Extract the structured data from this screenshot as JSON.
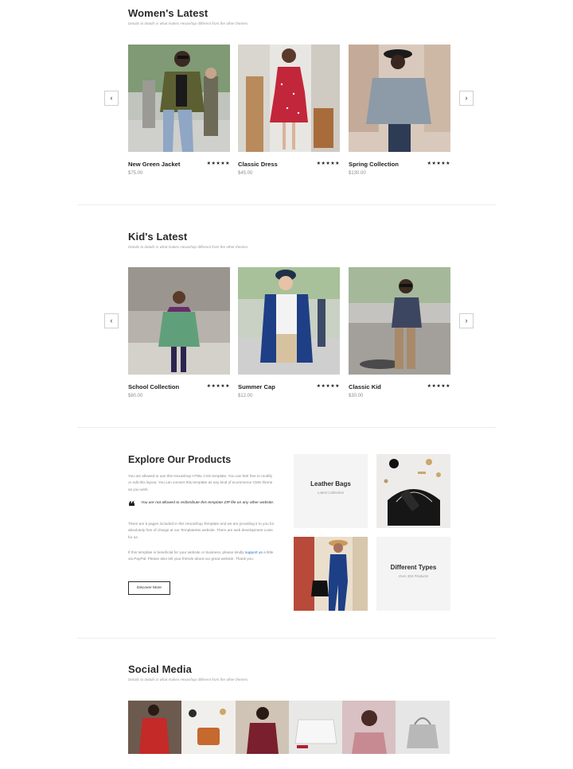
{
  "womens": {
    "title": "Women's Latest",
    "subtitle": "Details to details is what makes Hexashop different from the other themes.",
    "products": [
      {
        "name": "New Green Jacket",
        "price": "$75.00",
        "rating": "★★★★★"
      },
      {
        "name": "Classic Dress",
        "price": "$45.00",
        "rating": "★★★★★"
      },
      {
        "name": "Spring Collection",
        "price": "$130.00",
        "rating": "★★★★★"
      }
    ]
  },
  "kids": {
    "title": "Kid's Latest",
    "subtitle": "Details to details is what makes Hexashop different from the other themes.",
    "products": [
      {
        "name": "School Collection",
        "price": "$80.00",
        "rating": "★★★★★"
      },
      {
        "name": "Summer Cap",
        "price": "$12.00",
        "rating": "★★★★★"
      },
      {
        "name": "Classic Kid",
        "price": "$30.00",
        "rating": "★★★★★"
      }
    ]
  },
  "carousel": {
    "prev_icon": "‹",
    "next_icon": "›"
  },
  "explore": {
    "title": "Explore Our Products",
    "intro": "You are allowed to use this HexaShop HTML CSS template. You can feel free to modify or edit this layout. You can convert this template as any kind of ecommerce CMS theme as you wish.",
    "quote_icon": "❝",
    "quote": "You are not allowed to redistribute this template ZIP file on any other website.",
    "para2": "There are 5 pages included in this HexaShop Template and we are providing it to you for absolutely free of charge at our TemplateMo website. There are web development costs for us.",
    "para3_before": "If this template is beneficial for your website or business, please kindly",
    "para3_link": "support us",
    "para3_after": "a little via PayPal. Please also tell your friends about our great website. Thank you.",
    "button": "Discover More",
    "tiles": [
      {
        "title": "Leather Bags",
        "subtitle": "Latest Collection"
      },
      {
        "title": "Different Types",
        "subtitle": "Over 304 Products"
      }
    ]
  },
  "social": {
    "title": "Social Media",
    "subtitle": "Details to details is what makes Hexashop different from the other themes."
  },
  "colors": {
    "accent_link": "#1a6fd8",
    "text_dark": "#2a2a2a",
    "muted": "#9a9a9a",
    "tile_bg": "#f4f4f4"
  }
}
